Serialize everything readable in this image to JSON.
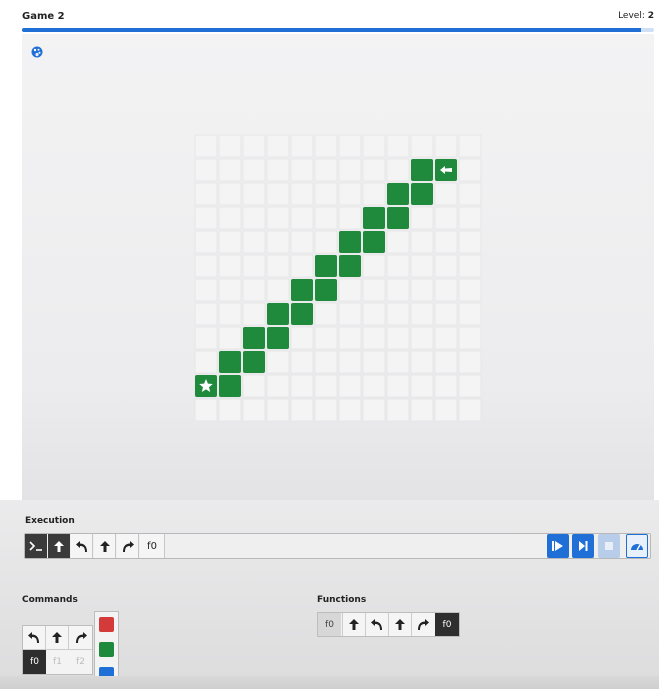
{
  "header": {
    "title": "Game 2",
    "level_label": "Level:",
    "level_value": "2",
    "progress_fraction": 0.98
  },
  "palette_icon": "palette-icon",
  "board": {
    "cols": 12,
    "rows": 12,
    "tile_color": "#1f8a3c",
    "green_tiles": [
      [
        9,
        1
      ],
      [
        10,
        1
      ],
      [
        8,
        2
      ],
      [
        9,
        2
      ],
      [
        7,
        3
      ],
      [
        8,
        3
      ],
      [
        6,
        4
      ],
      [
        7,
        4
      ],
      [
        5,
        5
      ],
      [
        6,
        5
      ],
      [
        4,
        6
      ],
      [
        5,
        6
      ],
      [
        3,
        7
      ],
      [
        4,
        7
      ],
      [
        2,
        8
      ],
      [
        3,
        8
      ],
      [
        1,
        9
      ],
      [
        2,
        9
      ],
      [
        0,
        10
      ],
      [
        1,
        10
      ]
    ],
    "star_tile": [
      0,
      10
    ],
    "player_tile": [
      10,
      1
    ],
    "star_icon": "star-icon",
    "player_icon": "arrow-player-icon"
  },
  "execution": {
    "label": "Execution",
    "sequence": [
      "terminal-icon",
      "forward-arrow-icon",
      "turn-left-icon",
      "forward-arrow-icon",
      "turn-right-icon",
      "f0"
    ],
    "controls": [
      "step-play-icon",
      "skip-icon",
      "stop-icon",
      "speed-icon"
    ]
  },
  "commands": {
    "label": "Commands",
    "row1": [
      "turn-left-icon",
      "forward-arrow-icon",
      "turn-right-icon"
    ],
    "row2": [
      "f0",
      "f1",
      "f2"
    ],
    "colors": [
      "#d53a3a",
      "#1f8a3c",
      "#1f6fd6"
    ]
  },
  "functions": {
    "label": "Functions",
    "name": "f0",
    "items": [
      "forward-arrow-icon",
      "turn-left-icon",
      "forward-arrow-icon",
      "turn-right-icon",
      "f0"
    ]
  }
}
